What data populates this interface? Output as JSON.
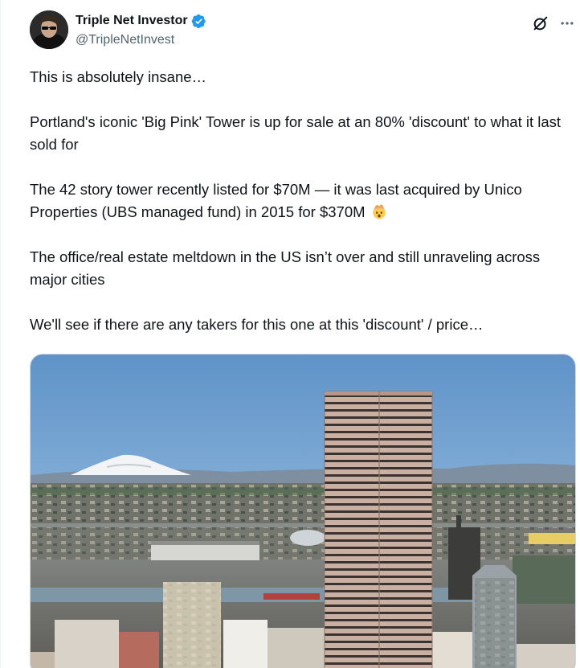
{
  "author": {
    "display_name": "Triple Net Investor",
    "handle": "@TripleNetInvest",
    "verified": true,
    "verified_color": "#1d9bf0"
  },
  "actions": {
    "grok_icon": "grok-icon",
    "more_icon": "more-icon"
  },
  "tweet": {
    "paragraphs": [
      "This is absolutely insane…",
      "Portland's iconic 'Big Pink' Tower is up for sale at an 80% 'discount' to what it last sold for",
      "The 42 story tower recently listed for $70M — it was last acquired by Unico Properties (UBS managed fund) in 2015 for $370M",
      "The office/real estate meltdown in the US isn’t over and still unraveling across major cities",
      "We'll see if there are any takers for this one at this 'discount' / price…"
    ],
    "emoji": "exploding-head-emoji"
  },
  "media": {
    "description_icon": "photo-of-portland-big-pink-tower"
  }
}
